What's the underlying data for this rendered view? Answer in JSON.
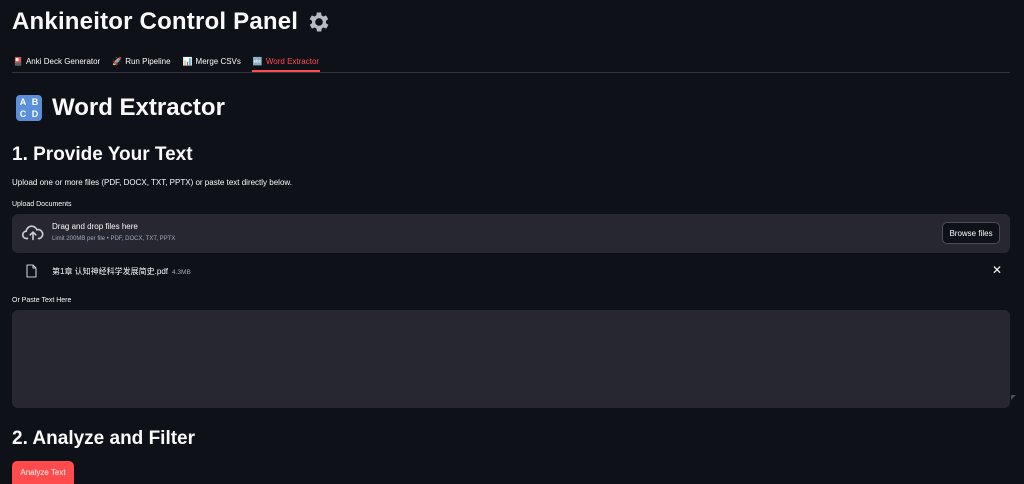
{
  "app": {
    "title": "Ankineitor Control Panel"
  },
  "tabs": [
    {
      "icon": "🎴",
      "label": "Anki Deck Generator"
    },
    {
      "icon": "🚀",
      "label": "Run Pipeline"
    },
    {
      "icon": "📊",
      "label": "Merge CSVs"
    },
    {
      "icon": "🔤",
      "label": "Word Extractor",
      "active": true
    }
  ],
  "page": {
    "title": "Word Extractor",
    "section1": {
      "heading": "1. Provide Your Text",
      "description": "Upload one or more files (PDF, DOCX, TXT, PPTX) or paste text directly below."
    },
    "upload": {
      "label": "Upload Documents",
      "dropzone_title": "Drag and drop files here",
      "dropzone_limit": "Limit 200MB per file • PDF, DOCX, TXT, PPTX",
      "browse_label": "Browse files"
    },
    "uploaded_file": {
      "name": "第1章 认知神经科学发展简史.pdf",
      "size": "4.3MB"
    },
    "paste": {
      "label": "Or Paste Text Here",
      "value": ""
    },
    "section2": {
      "heading": "2. Analyze and Filter"
    },
    "analyze_button": "Analyze Text"
  },
  "colors": {
    "accent": "#ff4b4b",
    "background": "#0e1117",
    "surface": "#262730"
  }
}
